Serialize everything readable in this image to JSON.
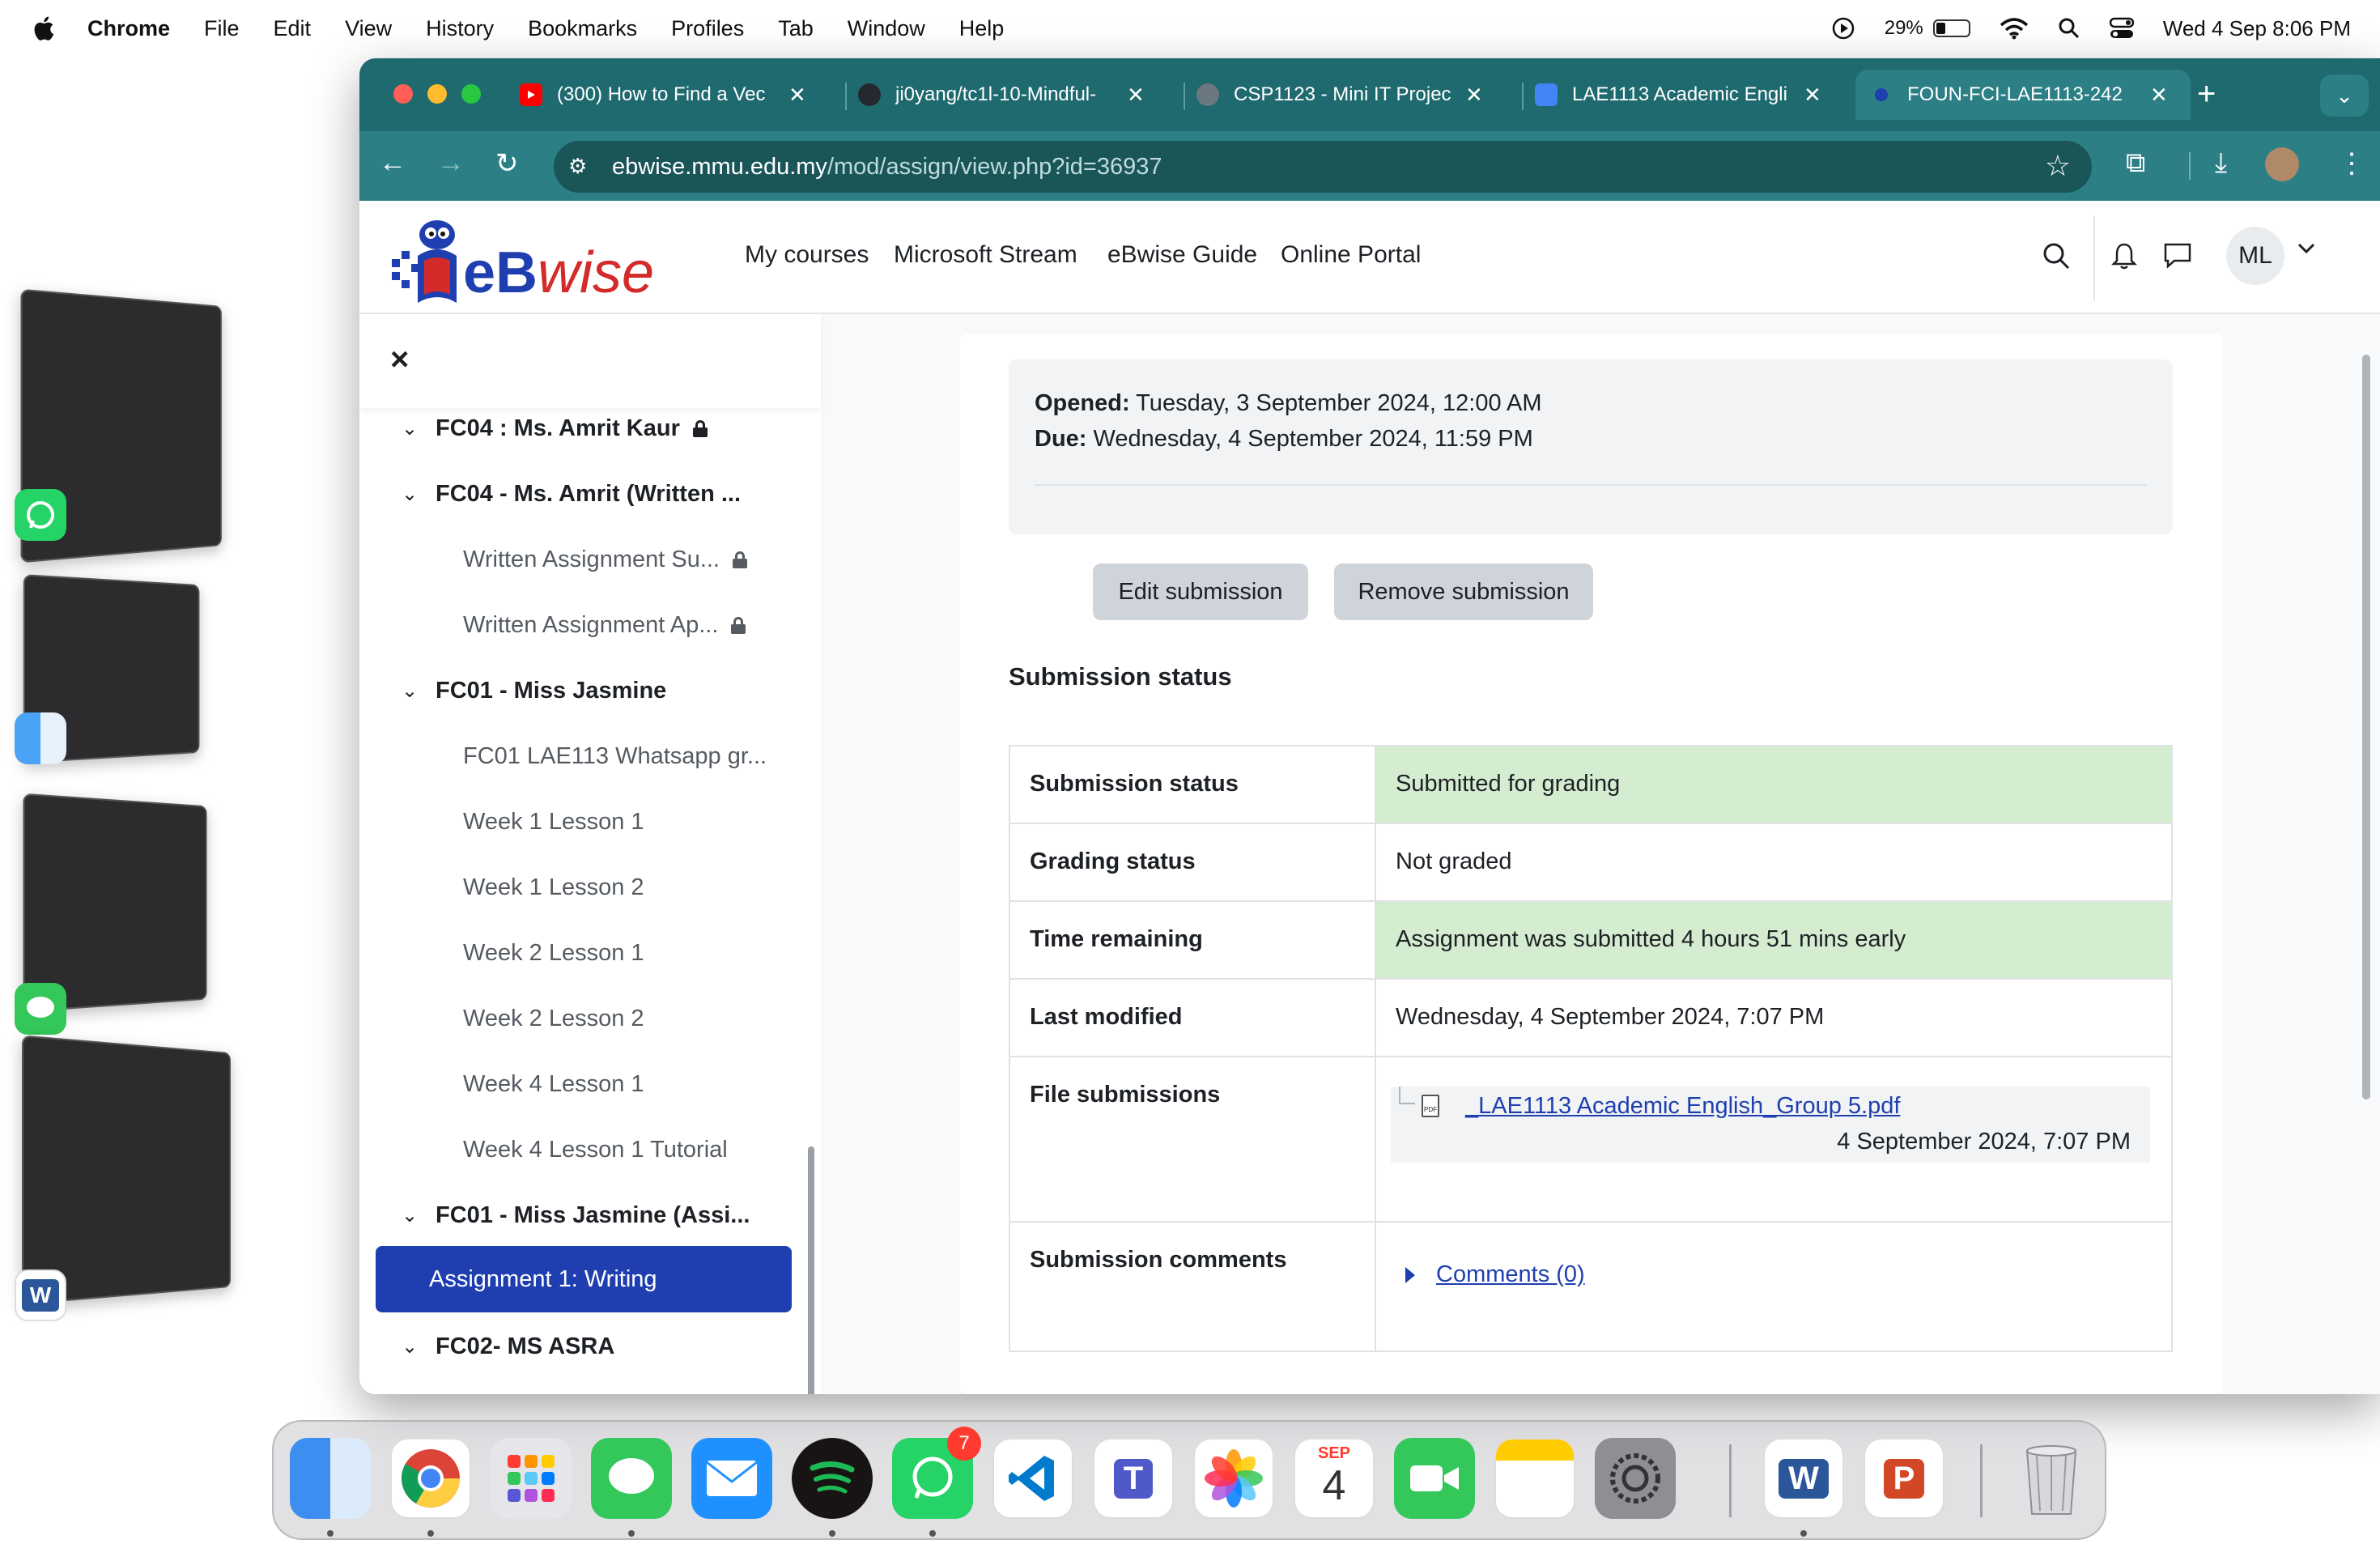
{
  "menubar": {
    "app_name": "Chrome",
    "items": [
      "File",
      "Edit",
      "View",
      "History",
      "Bookmarks",
      "Profiles",
      "Tab",
      "Window",
      "Help"
    ],
    "battery": "29%",
    "datetime": "Wed 4 Sep  8:06 PM"
  },
  "browser": {
    "tabs": [
      {
        "title": "(300) How to Find a Vec",
        "icon": "youtube-icon"
      },
      {
        "title": "ji0yang/tc1l-10-Mindful-",
        "icon": "github-icon"
      },
      {
        "title": "CSP1123 - Mini IT Projec",
        "icon": "globe-icon"
      },
      {
        "title": "LAE1113 Academic Engli",
        "icon": "docs-icon"
      },
      {
        "title": "FOUN-FCI-LAE1113-242",
        "icon": "ebwise-icon",
        "active": true
      }
    ],
    "url_host": "ebwise.mmu.edu.my",
    "url_path": "/mod/assign/view.php?id=36937"
  },
  "site": {
    "logo_text": "eBwise",
    "nav": [
      "My courses",
      "Microsoft Stream",
      "eBwise Guide",
      "Online Portal"
    ],
    "user_initials": "ML"
  },
  "drawer": {
    "close_label": "×",
    "items": [
      {
        "type": "section",
        "label": "FC04 : Ms. Amrit Kaur",
        "locked": true
      },
      {
        "type": "section",
        "label": "FC04 - Ms. Amrit (Written ...",
        "locked": false
      },
      {
        "type": "activity",
        "label": "Written Assignment Su...",
        "locked": true
      },
      {
        "type": "activity",
        "label": "Written Assignment Ap...",
        "locked": true
      },
      {
        "type": "section",
        "label": "FC01 - Miss Jasmine",
        "locked": false
      },
      {
        "type": "activity",
        "label": "FC01 LAE113 Whatsapp gr...",
        "locked": false
      },
      {
        "type": "activity",
        "label": "Week 1 Lesson 1",
        "locked": false
      },
      {
        "type": "activity",
        "label": "Week 1 Lesson 2",
        "locked": false
      },
      {
        "type": "activity",
        "label": "Week 2 Lesson 1",
        "locked": false
      },
      {
        "type": "activity",
        "label": "Week 2 Lesson 2",
        "locked": false
      },
      {
        "type": "activity",
        "label": "Week 4 Lesson 1",
        "locked": false
      },
      {
        "type": "activity",
        "label": "Week 4 Lesson 1 Tutorial",
        "locked": false
      },
      {
        "type": "section",
        "label": "FC01 - Miss Jasmine (Assi...",
        "locked": false
      },
      {
        "type": "active",
        "label": "Assignment 1: Writing",
        "locked": false
      },
      {
        "type": "section",
        "label": "FC02- MS ASRA",
        "locked": false
      }
    ]
  },
  "assignment": {
    "opened_label": "Opened:",
    "opened_value": "Tuesday, 3 September 2024, 12:00 AM",
    "due_label": "Due:",
    "due_value": "Wednesday, 4 September 2024, 11:59 PM",
    "edit_button": "Edit submission",
    "remove_button": "Remove submission",
    "section_title": "Submission status",
    "rows": [
      {
        "key": "Submission status",
        "value": "Submitted for grading",
        "highlight": true
      },
      {
        "key": "Grading status",
        "value": "Not graded",
        "highlight": false
      },
      {
        "key": "Time remaining",
        "value": "Assignment was submitted 4 hours 51 mins early",
        "highlight": true
      },
      {
        "key": "Last modified",
        "value": "Wednesday, 4 September 2024, 7:07 PM",
        "highlight": false
      }
    ],
    "file_submissions_label": "File submissions",
    "file_name": "_LAE1113 Academic English_Group 5.pdf",
    "file_date": "4 September 2024, 7:07 PM",
    "comments_label": "Submission comments",
    "comments_link": "Comments (0)"
  },
  "dock": {
    "apps": [
      "Finder",
      "Chrome",
      "Launchpad",
      "Messages",
      "Mail",
      "Spotify",
      "WhatsApp",
      "VS Code",
      "Teams",
      "Photos",
      "Calendar",
      "FaceTime",
      "Notes",
      "System Settings",
      "Word",
      "PowerPoint",
      "Trash"
    ],
    "whatsapp_badge": "7",
    "calendar_month": "SEP",
    "calendar_day": "4"
  },
  "colors": {
    "chrome_tabstrip": "#1e6a6f",
    "chrome_toolbar": "#2b7f85",
    "accent_blue": "#1f3fb0",
    "success_green": "#d4ecd0"
  }
}
